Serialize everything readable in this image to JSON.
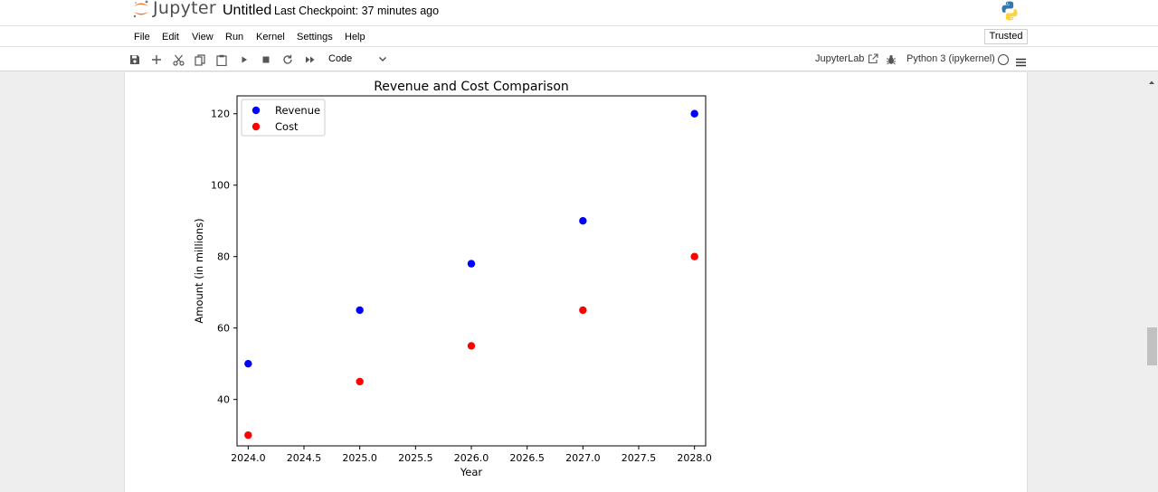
{
  "header": {
    "logo_text": "Jupyter",
    "notebook_name": "Untitled",
    "checkpoint": "Last Checkpoint: 37 minutes ago"
  },
  "menu": [
    "File",
    "Edit",
    "View",
    "Run",
    "Kernel",
    "Settings",
    "Help"
  ],
  "trusted": "Trusted",
  "toolbar": {
    "buttons": [
      "save-icon",
      "add-cell-icon",
      "cut-icon",
      "copy-icon",
      "paste-icon",
      "run-icon",
      "stop-icon",
      "restart-icon",
      "fast-forward-icon"
    ],
    "cell_type": "Code",
    "jupyterlab_link": "JupyterLab",
    "kernel_name": "Python 3 (ipykernel)"
  },
  "chart_data": {
    "type": "scatter",
    "title": "Revenue and Cost Comparison",
    "xlabel": "Year",
    "ylabel": "Amount (in millions)",
    "xlim": [
      2023.9,
      2028.1
    ],
    "ylim": [
      27,
      125
    ],
    "xticks": [
      2024.0,
      2024.5,
      2025.0,
      2025.5,
      2026.0,
      2026.5,
      2027.0,
      2027.5,
      2028.0
    ],
    "xtick_labels": [
      "2024.0",
      "2024.5",
      "2025.0",
      "2025.5",
      "2026.0",
      "2026.5",
      "2027.0",
      "2027.5",
      "2028.0"
    ],
    "yticks": [
      40,
      60,
      80,
      100,
      120
    ],
    "ytick_labels": [
      "40",
      "60",
      "80",
      "100",
      "120"
    ],
    "grid": false,
    "legend": "upper-left",
    "series": [
      {
        "name": "Revenue",
        "color": "#0000ff",
        "x": [
          2024,
          2025,
          2026,
          2027,
          2028
        ],
        "y": [
          50,
          65,
          78,
          90,
          120
        ]
      },
      {
        "name": "Cost",
        "color": "#ff0000",
        "x": [
          2024,
          2025,
          2026,
          2027,
          2028
        ],
        "y": [
          30,
          45,
          55,
          65,
          80
        ]
      }
    ]
  }
}
